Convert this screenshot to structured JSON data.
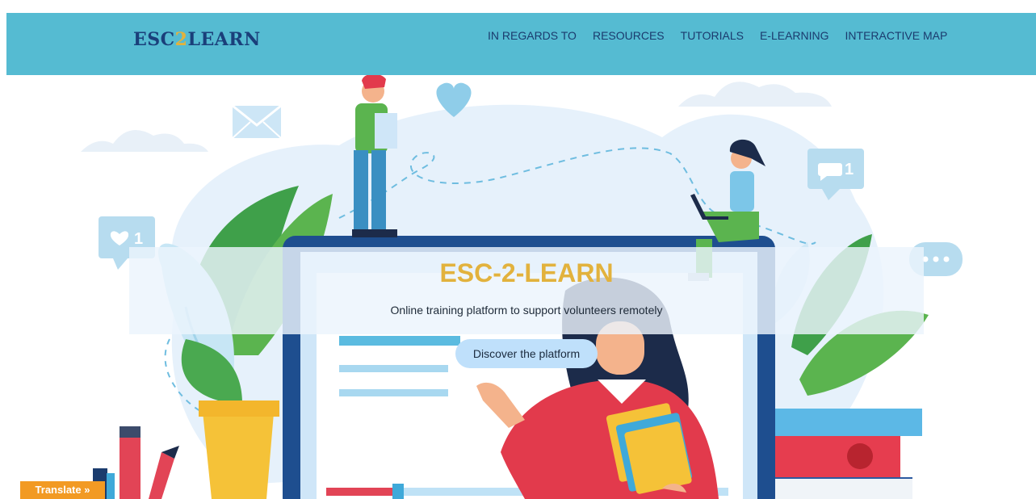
{
  "brand": {
    "logo_prefix": "ESC",
    "logo_digit": "2",
    "logo_suffix": "LEARN"
  },
  "nav": {
    "items": [
      "IN REGARDS TO",
      "RESOURCES",
      "TUTORIALS",
      "E-LEARNING",
      "INTERACTIVE MAP"
    ]
  },
  "hero": {
    "title": "ESC-2-LEARN",
    "subtitle": "Online training platform to support volunteers remotely",
    "cta_label": "Discover the platform",
    "like_count": "1",
    "comment_count": "1"
  },
  "translate": {
    "label": "Translate »"
  },
  "colors": {
    "navbar": "#55bbd2",
    "logo": "#1a3f7a",
    "accent_gold": "#e2b23d",
    "cta_bg": "#bfe0fb",
    "translate_bg": "#f29a23"
  }
}
